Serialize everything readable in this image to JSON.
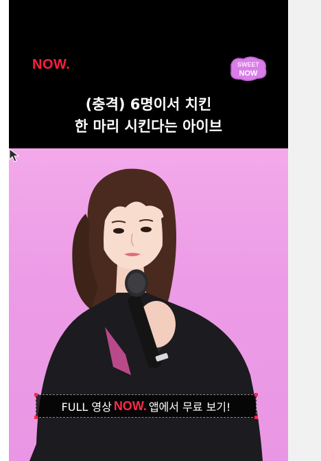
{
  "brand": {
    "logo_text": "NOW.",
    "logo_color": "#ff1f3d",
    "badge_text_top": "SWEET",
    "badge_text_bottom": "NOW"
  },
  "headline": {
    "line1": "(충격) 6명이서 치킨",
    "line2": "한 마리 시킨다는 아이브"
  },
  "cta": {
    "prefix": "FULL 영상",
    "brand": "NOW.",
    "suffix": "앱에서 무료 보기!"
  },
  "colors": {
    "background_pink": "#ec9be6",
    "accent_red": "#ff2a48",
    "band": "#000000"
  },
  "icons": [
    "microphone-icon",
    "cursor-icon"
  ]
}
